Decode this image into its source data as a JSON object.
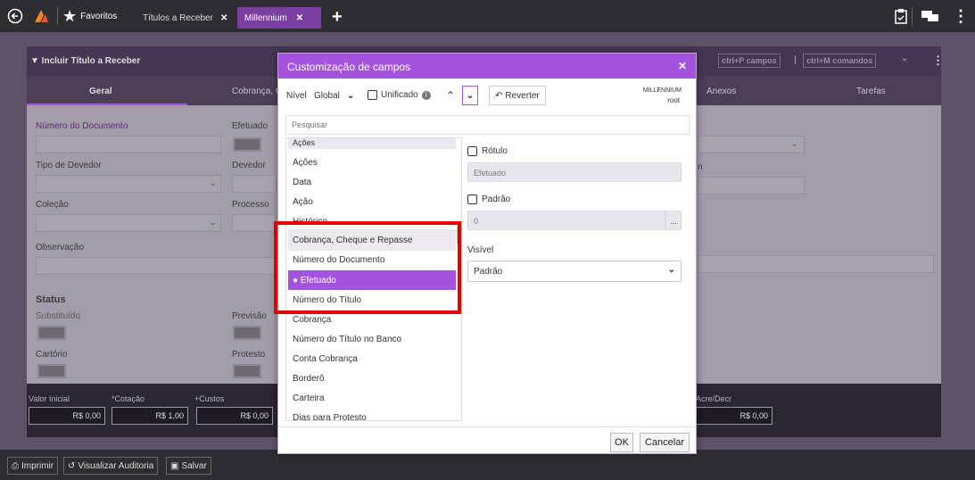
{
  "topbar": {
    "back_icon": "arrow-left-circle-icon",
    "logo_icon": "millennium-logo-icon",
    "favorites_label": "Favoritos",
    "tabs": [
      {
        "label": "Títulos a Receber",
        "close": "✕",
        "active": false
      },
      {
        "label": "Millennium",
        "close": "✕",
        "active": true
      }
    ],
    "add_tab": "+"
  },
  "card": {
    "title": "▼ Incluir Título a Receber",
    "right_hints": [
      "ctrl+P campos",
      "|",
      "ctrl+M comandos",
      "⌄",
      "⋮"
    ],
    "tabs": [
      "Geral",
      "Cobrança, C",
      "Anexos",
      "Tarefas"
    ],
    "fields": {
      "numero_documento": "Número do Documento",
      "efetuado": "Efetuado",
      "tipo_devedor": "Tipo de Devedor",
      "devedor": "Devedor",
      "colecao": "Coleção",
      "processo": "Processo",
      "observacao": "Observação",
      "partial_n": "n",
      "status": "Status",
      "substituido": "Substituído",
      "previsao": "Previsão",
      "cartorio": "Cartório",
      "protesto": "Protesto"
    },
    "summary": {
      "valor_inicial": "Valor Inicial",
      "cotacao": "*Cotação",
      "custos": "+Custos",
      "acre": "Acre/Decr",
      "v1": "R$ 0,00",
      "v2": "R$ 1,00",
      "v3": "R$ 0,00",
      "v4": "R$ 0,00"
    }
  },
  "bottombar": {
    "imprimir": "Imprimir",
    "auditoria": "Visualizar Auditoria",
    "salvar": "Salvar"
  },
  "modal": {
    "title": "Customização de campos",
    "close": "✕",
    "nivel_label": "Nível",
    "nivel_value": "Global",
    "unificado_label": "Unificado",
    "reverter_label": "Reverter",
    "user_line1": "MILLENNIUM",
    "user_line2": "root",
    "search_placeholder": "Pesquisar",
    "list": [
      "Ações",
      "Ações",
      "Data",
      "Ação",
      "Histórico",
      "Cobrança, Cheque e Repasse",
      "Número do Documento",
      "Efetuado",
      "Número do Título",
      "Cobrança",
      "Número do Título no Banco",
      "Conta Cobrança",
      "Borderô",
      "Carteira",
      "Dias para Protesto"
    ],
    "selected": "Efetuado",
    "rotulo_label": "Rótulo",
    "rotulo_value": "Efetuado",
    "padrao_label": "Padrão",
    "padrao_value": "0",
    "padrao_btn": "...",
    "visivel_label": "Visível",
    "visivel_value": "Padrão",
    "ok": "OK",
    "cancel": "Cancelar"
  },
  "colors": {
    "accent": "#a353de",
    "highlight": "#e60000"
  }
}
